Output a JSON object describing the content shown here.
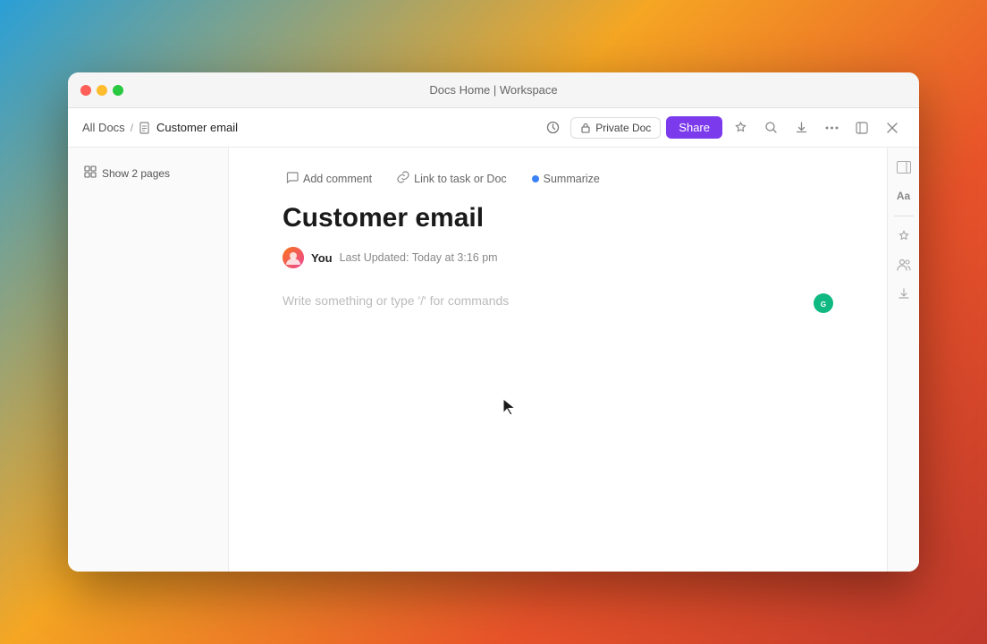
{
  "window": {
    "title": "Docs Home | Workspace",
    "traffic_lights": {
      "close": "close",
      "minimize": "minimize",
      "maximize": "maximize"
    }
  },
  "breadcrumb": {
    "root": "All Docs",
    "separator": "/",
    "current": "Customer email",
    "doc_icon": "📄"
  },
  "nav_actions": {
    "history_icon": "↺",
    "private_doc_label": "Private Doc",
    "lock_icon": "🔒",
    "share_label": "Share",
    "star_icon": "★",
    "search_icon": "⌕",
    "export_icon": "↓",
    "more_icon": "···",
    "collapse_icon": "⊡",
    "close_icon": "✕"
  },
  "sidebar": {
    "show_pages_label": "Show 2 pages",
    "pages_icon": "⊞"
  },
  "doc_toolbar": {
    "add_comment_label": "Add comment",
    "add_comment_icon": "💬",
    "link_task_label": "Link to task or Doc",
    "link_task_icon": "🔗",
    "summarize_label": "Summarize"
  },
  "document": {
    "title": "Customer email",
    "author": "You",
    "last_updated_prefix": "Last Updated:",
    "last_updated_time": "Today at 3:16 pm",
    "write_placeholder": "Write something or type '/' for commands"
  },
  "right_sidebar": {
    "font_icon": "Aa",
    "star_icon": "☆",
    "people_icon": "👤",
    "download_icon": "↓"
  },
  "colors": {
    "share_button_bg": "#7c3aed",
    "ai_icon_bg": "#10b981",
    "summarize_dot": "#3b82f6"
  }
}
